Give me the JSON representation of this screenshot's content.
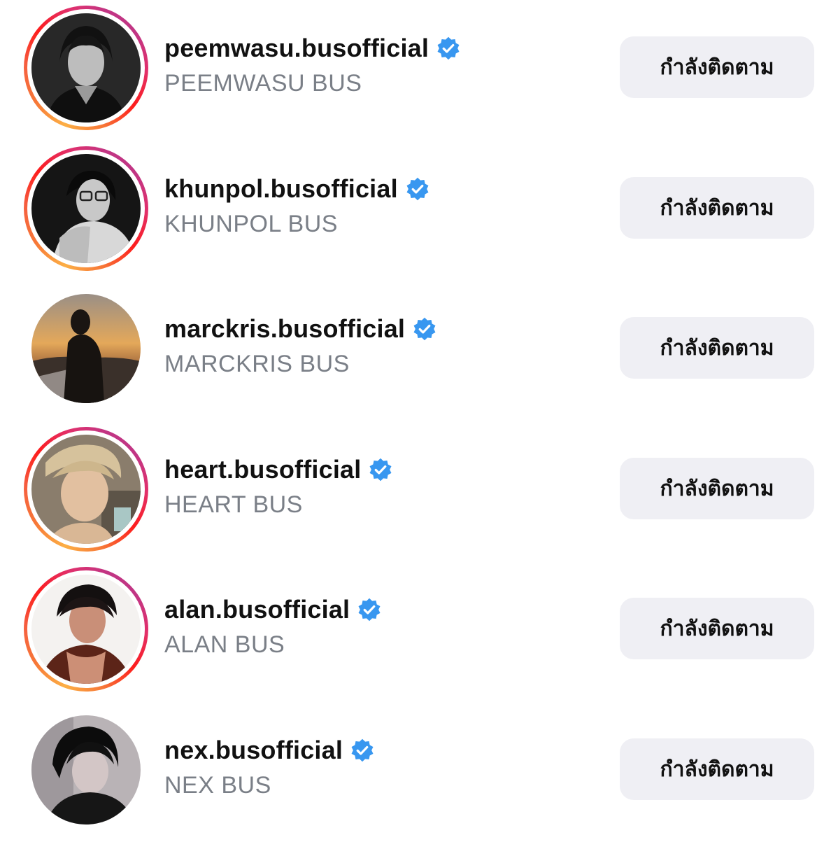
{
  "following": [
    {
      "username": "peemwasu.busofficial",
      "full_name": "PEEMWASU BUS",
      "verified": true,
      "has_story": true,
      "button_label": "กำลังติดตาม"
    },
    {
      "username": "khunpol.busofficial",
      "full_name": "KHUNPOL BUS",
      "verified": true,
      "has_story": true,
      "button_label": "กำลังติดตาม"
    },
    {
      "username": "marckris.busofficial",
      "full_name": "MARCKRIS BUS",
      "verified": true,
      "has_story": false,
      "button_label": "กำลังติดตาม"
    },
    {
      "username": "heart.busofficial",
      "full_name": "HEART BUS",
      "verified": true,
      "has_story": true,
      "button_label": "กำลังติดตาม"
    },
    {
      "username": "alan.busofficial",
      "full_name": "ALAN BUS",
      "verified": true,
      "has_story": true,
      "button_label": "กำลังติดตาม"
    },
    {
      "username": "nex.busofficial",
      "full_name": "NEX BUS",
      "verified": true,
      "has_story": false,
      "button_label": "กำลังติดตาม"
    }
  ],
  "colors": {
    "verified_badge": "#3897f0",
    "button_bg": "#efeff4",
    "secondary_text": "#7a7f87"
  },
  "icons": {
    "verified": "verified-badge-icon",
    "avatar": "profile-photo"
  }
}
